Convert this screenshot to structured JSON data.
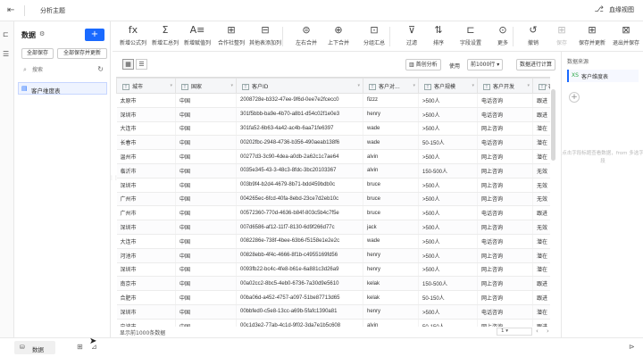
{
  "topbar": {
    "title": "分析主题",
    "right_label": "血缘视图"
  },
  "data_panel": {
    "title": "数据",
    "add_label": "+",
    "btn_save_all": "全部保存",
    "btn_save_update": "全部保存并更新",
    "search_placeholder": "搜索",
    "item_label": "客户维度表"
  },
  "toolbar": [
    {
      "name": "new-formula-column",
      "icon": "fx",
      "label": "新增公式列",
      "enabled": true
    },
    {
      "name": "new-summary-column",
      "icon": "Σ",
      "label": "新增汇总列",
      "enabled": true
    },
    {
      "name": "new-assign-column",
      "icon": "A≡",
      "label": "新增赋值列",
      "enabled": true
    },
    {
      "name": "new-other-column",
      "icon": "⊞",
      "label": "合作社整列",
      "enabled": true
    },
    {
      "name": "other-table-column",
      "icon": "⊟",
      "label": "其他表添加列",
      "enabled": true
    },
    {
      "name": "left-right-merge",
      "icon": "⊜",
      "label": "左右合并",
      "enabled": true
    },
    {
      "name": "up-down-merge",
      "icon": "⊕",
      "label": "上下合并",
      "enabled": true
    },
    {
      "name": "group-summary",
      "icon": "⊡",
      "label": "分组汇总",
      "enabled": true
    },
    {
      "name": "filter",
      "icon": "⊽",
      "label": "过滤",
      "enabled": true
    },
    {
      "name": "sort",
      "icon": "⇅",
      "label": "排序",
      "enabled": true
    },
    {
      "name": "field-settings",
      "icon": "⊏",
      "label": "字段设置",
      "enabled": true
    },
    {
      "name": "more",
      "icon": "⊙",
      "label": "更多",
      "enabled": true
    },
    {
      "name": "undo",
      "icon": "↺",
      "label": "撤销",
      "enabled": true
    },
    {
      "name": "save",
      "icon": "⊞",
      "label": "保存",
      "enabled": false
    },
    {
      "name": "save-and-update",
      "icon": "⊞",
      "label": "保存并更新",
      "enabled": true
    },
    {
      "name": "exit-and-save",
      "icon": "⊠",
      "label": "退出并保存",
      "enabled": true
    }
  ],
  "subbar": {
    "btn_first_analysis": "首创分析",
    "use_label": "使用",
    "rows_select": "前1000行",
    "btn_auto_calc": "数据进行计算"
  },
  "table": {
    "columns": [
      "城市",
      "国家",
      "客户ID",
      "客户对...",
      "客户规模",
      "客户开发",
      "客"
    ],
    "rows": [
      [
        "太原市",
        "中国",
        "2008728e-b332-47ee-9f6d-0ee7e2fcecc0",
        "fizzz",
        ">500人",
        "电话咨询",
        "跟进"
      ],
      [
        "深圳市",
        "中国",
        "301f5bbb-ba9e-4b70-a8b1-d54c02f1e0e3",
        "henry",
        ">500人",
        "电话咨询",
        "跟进"
      ],
      [
        "大连市",
        "中国",
        "301fa52-6b63-4a42-ac4b-6aa71fe6397",
        "wade",
        ">500人",
        "网上咨询",
        "潜在"
      ],
      [
        "长春市",
        "中国",
        "00202fbc-2948-4736-b356-490aeab138f6",
        "wade",
        "50-150人",
        "电话咨询",
        "潜在"
      ],
      [
        "温州市",
        "中国",
        "00277d3-3c90-4dea-a0db-2a62c1c7ae64",
        "alvin",
        ">500人",
        "网上咨询",
        "潜在"
      ],
      [
        "临沂市",
        "中国",
        "0035e345-43-3-48c3-8fdc-3bc20103367",
        "alvin",
        "150-500人",
        "网上咨询",
        "无效"
      ],
      [
        "深圳市",
        "中国",
        "003b9f4-b2d4-4679-8b71-bdd459bdb0c",
        "bruce",
        ">500人",
        "网上咨询",
        "无效"
      ],
      [
        "广州市",
        "中国",
        "004265ec-6fcd-40fa-8ebd-23ce7d2eb10c",
        "bruce",
        ">500人",
        "网上咨询",
        "无效"
      ],
      [
        "广州市",
        "中国",
        "00572360-770d-4636-b84f-803c5b4c7f5e",
        "bruce",
        ">500人",
        "电话咨询",
        "跟进"
      ],
      [
        "深圳市",
        "中国",
        "007d6586-af12-11f7-8130-6d9f266d77c",
        "jack",
        ">500人",
        "网上咨询",
        "无效"
      ],
      [
        "大连市",
        "中国",
        "0082286e-738f-4bee-63b6-f5158e1e2e2c",
        "wade",
        ">500人",
        "电话咨询",
        "潜在"
      ],
      [
        "河池市",
        "中国",
        "00828ebb-4f4c-4666-8f1b-c4955169fd56",
        "henry",
        ">500人",
        "网上咨询",
        "潜在"
      ],
      [
        "深圳市",
        "中国",
        "0093fb22-bc4c-4fe8-b61e-6a881c3d26a9",
        "henry",
        ">500人",
        "网上咨询",
        "潜在"
      ],
      [
        "南京市",
        "中国",
        "00a02cc2-8bc5-4eb0-6736-7a30d9e5610",
        "kelak",
        "150-500人",
        "网上咨询",
        "跟进"
      ],
      [
        "合肥市",
        "中国",
        "00ba06d-a452-4757-a097-51be87713d65",
        "kelak",
        "50-150人",
        "网上咨询",
        "跟进"
      ],
      [
        "深圳市",
        "中国",
        "00bbfed0-c5e8-13cc-a69b-5fafc1390a81",
        "henry",
        ">500人",
        "电话咨询",
        "潜在"
      ],
      [
        "宁波市",
        "中国",
        "00c1d3e2-77ab-4c1d-9f02-3da7e1b5c608",
        "alvin",
        "50-150人",
        "网上咨询",
        "跟进"
      ]
    ]
  },
  "footer": {
    "count_text": "显示前1000条数据",
    "page": "1"
  },
  "right_panel": {
    "title": "数据来源",
    "source_label": "客户维度表",
    "hint": "点击字段标题查看数据，from 多选字段"
  },
  "bottombar": {
    "data_tab": "数据"
  }
}
